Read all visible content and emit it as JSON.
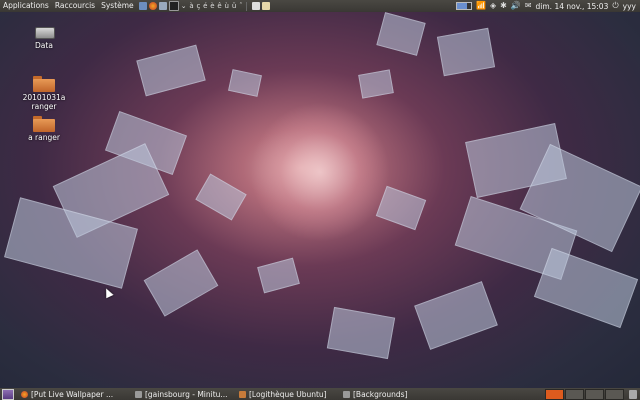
{
  "top_panel": {
    "menus": [
      "Applications",
      "Raccourcis",
      "Système"
    ],
    "special_chars": "⌄ à ç é è ê ù ü ˆ",
    "clock": "dim. 14 nov., 15:03",
    "user": "yyy"
  },
  "desktop": {
    "icons": [
      {
        "label": "Data",
        "icon": "drive-icon"
      },
      {
        "label": "20101031a ranger",
        "icon": "folder-icon"
      },
      {
        "label": "a ranger",
        "icon": "folder-icon"
      }
    ]
  },
  "taskbar": {
    "tasks": [
      {
        "label": "[Put Live Wallpaper ...",
        "icon": "firefox-icon"
      },
      {
        "label": "[gainsbourg - Minitu...",
        "icon": "window-icon"
      },
      {
        "label": "[Logithèque Ubuntu]",
        "icon": "software-center-icon"
      },
      {
        "label": "[Backgrounds]",
        "icon": "window-icon"
      }
    ]
  },
  "colors": {
    "panel": "#3f3d39",
    "accent": "#dd5b1e"
  }
}
